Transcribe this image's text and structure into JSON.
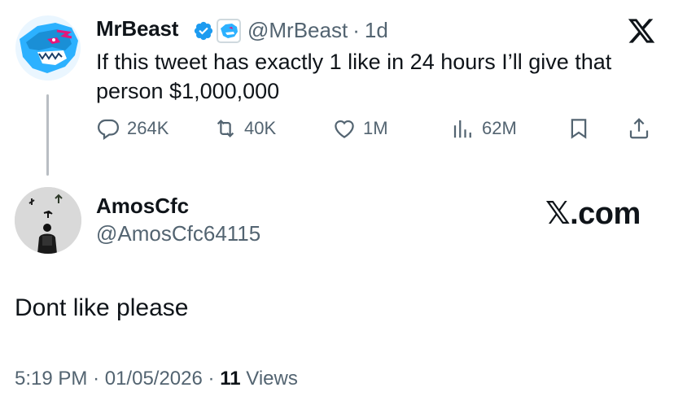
{
  "tweet": {
    "author_name": "MrBeast",
    "handle": "@MrBeast",
    "separator": "·",
    "age": "1d",
    "text": "If this tweet has exactly 1 like in 24 hours I’ll give that person $1,000,000",
    "verified_icon": "verified-badge-icon",
    "affiliate_icon": "mrbeast-affiliate-icon",
    "actions": {
      "replies": "264K",
      "reposts": "40K",
      "likes": "1M",
      "views": "62M"
    }
  },
  "reply": {
    "author_name": "AmosCfc",
    "handle": "@AmosCfc64115",
    "text": "Dont like please",
    "time": "5:19 PM",
    "dot1": "·",
    "date": "01/05/2026",
    "dot2": "·",
    "views_count": "11",
    "views_label": "Views"
  },
  "branding": {
    "watermark": "𝕏.com"
  },
  "colors": {
    "text": "#0f1419",
    "secondary": "#536471",
    "verified": "#1d9bf0",
    "mrbeast_blue": "#2cb1ff",
    "mrbeast_pink": "#e6167b"
  }
}
